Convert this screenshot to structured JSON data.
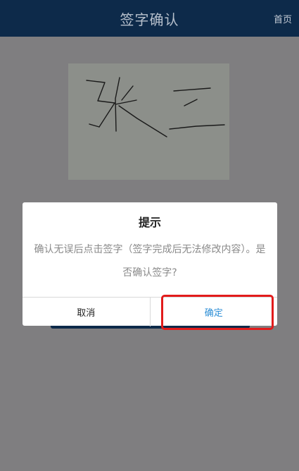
{
  "header": {
    "title": "签字确认",
    "home_link": "首页"
  },
  "signature": {
    "accent_color": "#1a1a1a"
  },
  "dialog": {
    "title": "提示",
    "message": "确认无误后点击签字（签字完成后无法修改内容）。是否确认签字?",
    "cancel_label": "取消",
    "confirm_label": "确定"
  },
  "colors": {
    "header_bg": "#0d2a4a",
    "overlay": "#7f7e80",
    "confirm_text": "#2c8ed6",
    "highlight": "#e21b1b"
  }
}
